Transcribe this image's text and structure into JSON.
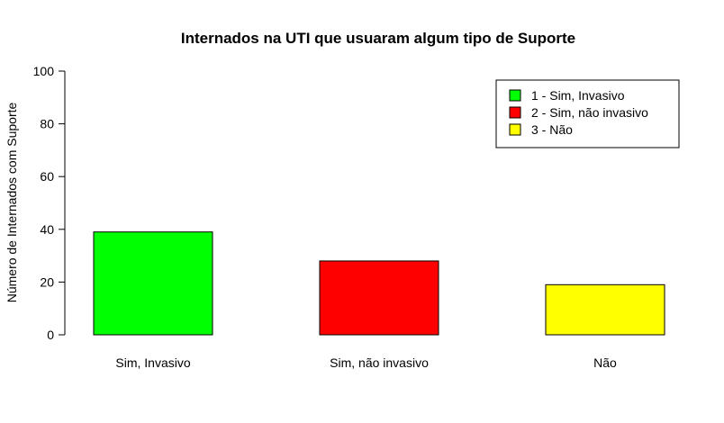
{
  "chart_data": {
    "type": "bar",
    "title": "Internados na UTI que usuaram algum tipo de Suporte",
    "xlabel": "",
    "ylabel": "Número de Internados com Suporte",
    "categories": [
      "Sim, Invasivo",
      "Sim, não invasivo",
      "Não"
    ],
    "values": [
      39,
      28,
      19
    ],
    "colors": [
      "#00ff00",
      "#ff0000",
      "#ffff00"
    ],
    "ylim": [
      0,
      100
    ],
    "yticks": [
      "0",
      "20",
      "40",
      "60",
      "80",
      "100"
    ],
    "grid": false,
    "legend": {
      "position": "top-right",
      "entries": [
        "1 - Sim, Invasivo",
        "2 - Sim, não invasivo",
        "3 - Não"
      ]
    }
  }
}
